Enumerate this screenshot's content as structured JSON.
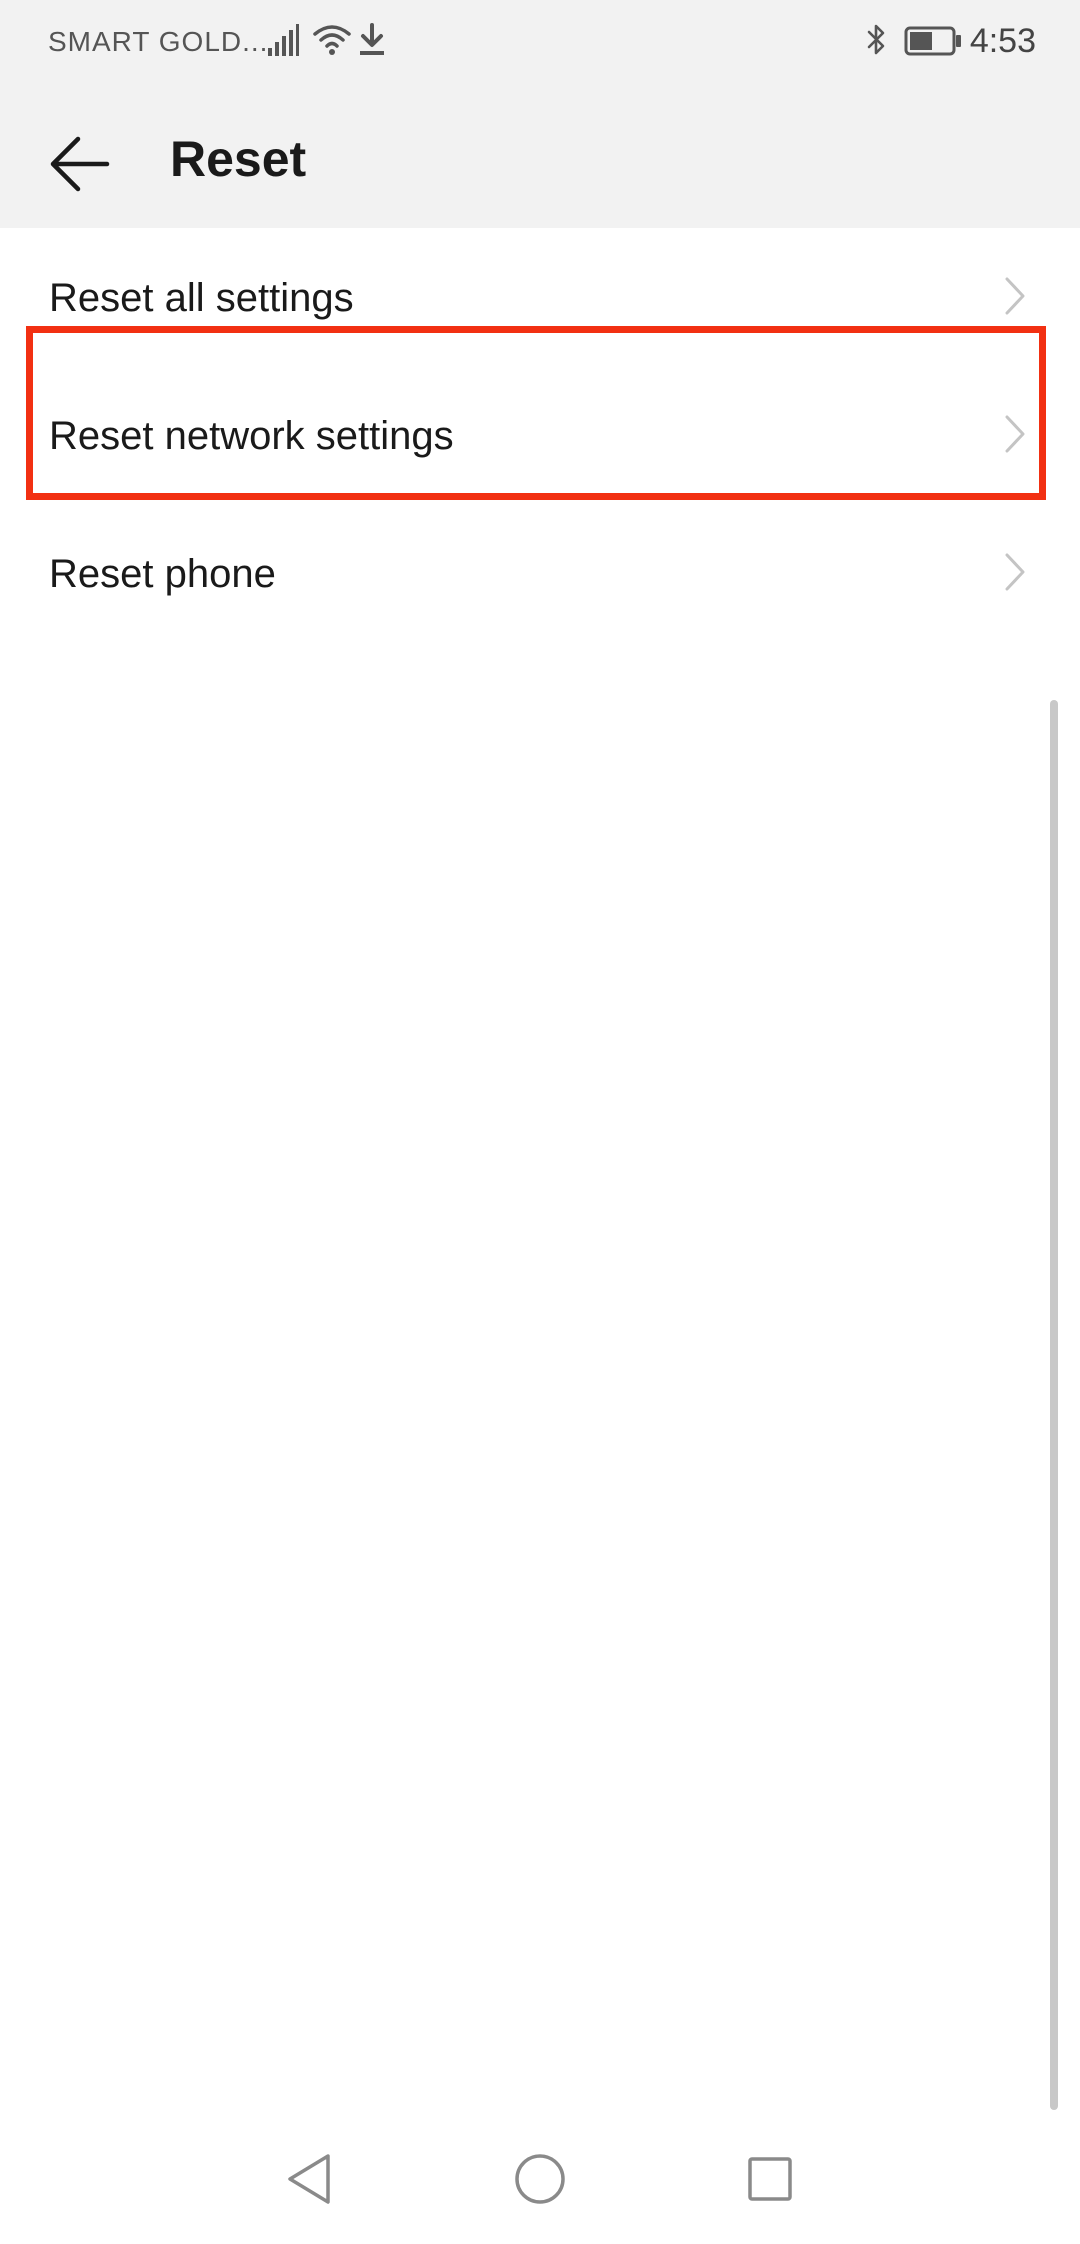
{
  "status_bar": {
    "carrier": "SMART GOLD...",
    "time": "4:53",
    "icons": [
      "signal-icon",
      "wifi-icon",
      "download-icon",
      "bluetooth-icon",
      "battery-icon"
    ]
  },
  "header": {
    "back_icon": "arrow-left-icon",
    "title": "Reset"
  },
  "list": {
    "items": [
      {
        "label": "Reset all settings",
        "icon": "chevron-right-icon",
        "highlighted": false
      },
      {
        "label": "Reset network settings",
        "icon": "chevron-right-icon",
        "highlighted": true
      },
      {
        "label": "Reset phone",
        "icon": "chevron-right-icon",
        "highlighted": false
      }
    ]
  },
  "nav_bar": {
    "icons": [
      "nav-back-icon",
      "nav-home-icon",
      "nav-recents-icon"
    ]
  },
  "colors": {
    "highlight": "#f23012",
    "header_bg": "#f2f2f2",
    "text": "#1a1a1a",
    "chevron": "#c4c4c4"
  }
}
